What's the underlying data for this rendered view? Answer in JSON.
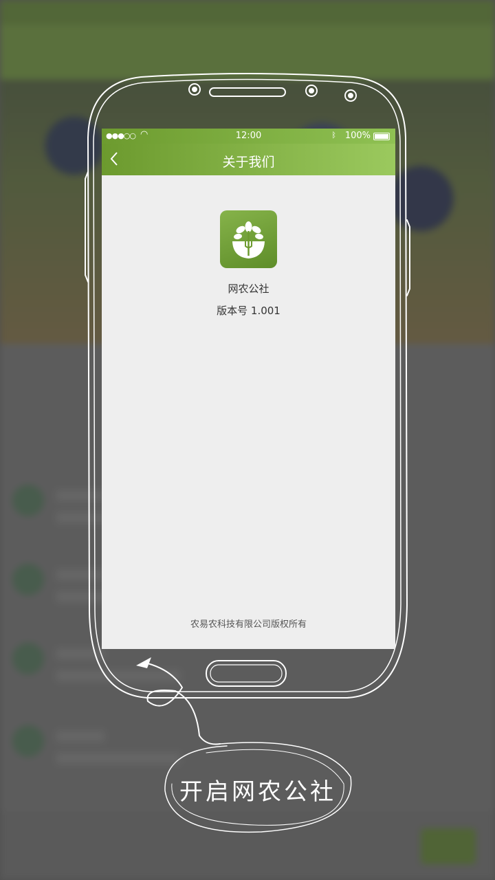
{
  "screen": {
    "status_bar": {
      "time": "12:00",
      "battery": "100%"
    },
    "nav": {
      "back_icon": "chevron-left-icon",
      "title": "关于我们"
    },
    "app": {
      "icon": "tree-bowl-logo",
      "name": "网农公社",
      "version": "版本号 1.001"
    },
    "footer": {
      "copyright": "农易农科技有限公司版权所有"
    }
  },
  "caption": "开启网农公社",
  "colors": {
    "accent": "#7aa83c",
    "screen_bg": "#eeeeee"
  }
}
